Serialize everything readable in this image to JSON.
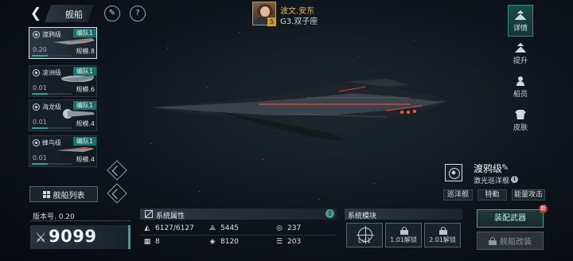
{
  "header": {
    "title": "舰船",
    "player": {
      "name": "波文.安东",
      "server": "G3.双子座",
      "level": "5"
    }
  },
  "fleet": {
    "ships": [
      {
        "class_name": "渡鸦级",
        "fleet": "编队1",
        "version": "0.20",
        "scale": "规模.8",
        "selected": true
      },
      {
        "class_name": "凌洲级",
        "fleet": "编队1",
        "version": "0.01",
        "scale": "规模.6",
        "selected": false
      },
      {
        "class_name": "海龙级",
        "fleet": "编队1",
        "version": "0.01",
        "scale": "规模.4",
        "selected": false
      },
      {
        "class_name": "蜂鸟级",
        "fleet": "编队1",
        "version": "0.01",
        "scale": "规模.4",
        "selected": false
      }
    ],
    "list_button": "舰船列表"
  },
  "stats": {
    "version_label": "版本号. 0.20",
    "power": "9099"
  },
  "attributes": {
    "title": "系统属性",
    "items": [
      {
        "icon": "armor-icon",
        "value": "6127/6127"
      },
      {
        "icon": "structure-icon",
        "value": "5445"
      },
      {
        "icon": "speed-icon",
        "value": "237"
      },
      {
        "icon": "grid-cells-icon",
        "value": "8"
      },
      {
        "icon": "target-icon",
        "value": "8120"
      },
      {
        "icon": "stack-icon",
        "value": "203"
      }
    ]
  },
  "modules": {
    "title": "系统模块",
    "slots": [
      {
        "label": "Lv.1",
        "locked": false
      },
      {
        "label": "1.01解锁",
        "locked": true
      },
      {
        "label": "2.01解锁",
        "locked": true
      }
    ]
  },
  "ship_info": {
    "name": "渡鸦级",
    "subtype": "激光巡洋舰",
    "traits": [
      "巡洋舰",
      "特勤",
      "能量攻击"
    ]
  },
  "actions": {
    "equip": "装配武器",
    "equip_badge": "新",
    "refit": "舰船改装"
  },
  "right_nav": [
    {
      "label": "详情",
      "active": true
    },
    {
      "label": "提升",
      "active": false
    },
    {
      "label": "船员",
      "active": false
    },
    {
      "label": "皮肤",
      "active": false
    }
  ],
  "colors": {
    "accent": "#2aa59a",
    "gold": "#e3bb4e",
    "badge": "#c1322a"
  }
}
